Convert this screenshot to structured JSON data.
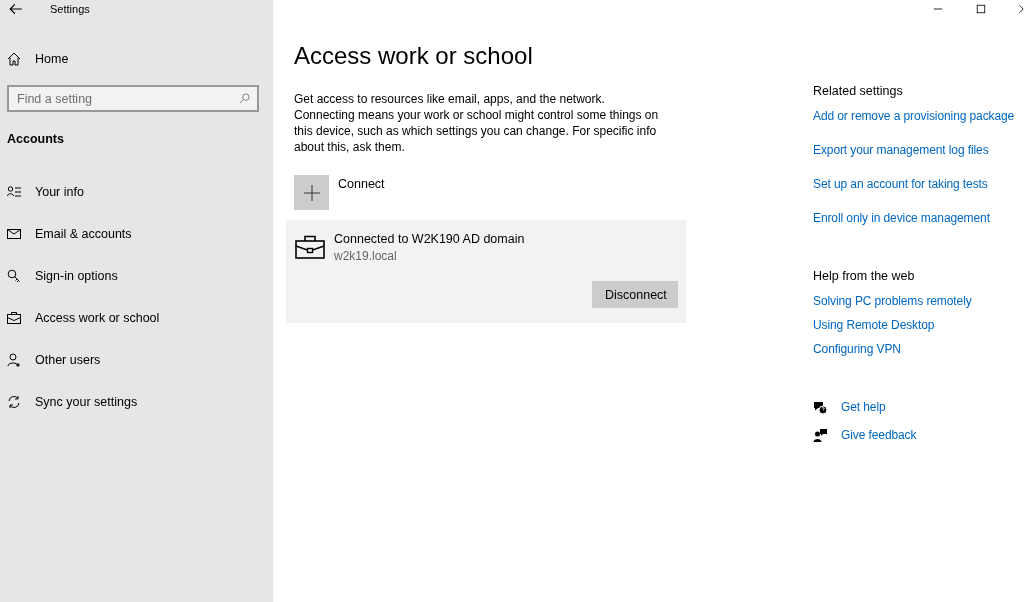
{
  "window": {
    "title": "Settings"
  },
  "sidebar": {
    "home": "Home",
    "search": {
      "placeholder": "Find a setting"
    },
    "section": "Accounts",
    "items": [
      {
        "label": "Your info"
      },
      {
        "label": "Email & accounts"
      },
      {
        "label": "Sign-in options"
      },
      {
        "label": "Access work or school"
      },
      {
        "label": "Other users"
      },
      {
        "label": "Sync your settings"
      }
    ]
  },
  "main": {
    "title": "Access work or school",
    "description": "Get access to resources like email, apps, and the network. Connecting means your work or school might control some things on this device, such as which settings you can change. For specific info about this, ask them.",
    "connect": "Connect",
    "connections": [
      {
        "name": "Connected to W2K190 AD domain",
        "domain": "w2k19.local",
        "button": "Disconnect"
      }
    ]
  },
  "related": {
    "heading": "Related settings",
    "links": [
      "Add or remove a provisioning package",
      "Export your management log files",
      "Set up an account for taking tests",
      "Enroll only in device management"
    ]
  },
  "help": {
    "heading": "Help from the web",
    "links": [
      "Solving PC problems remotely",
      "Using Remote Desktop",
      "Configuring VPN"
    ]
  },
  "support": [
    "Get help",
    "Give feedback"
  ]
}
